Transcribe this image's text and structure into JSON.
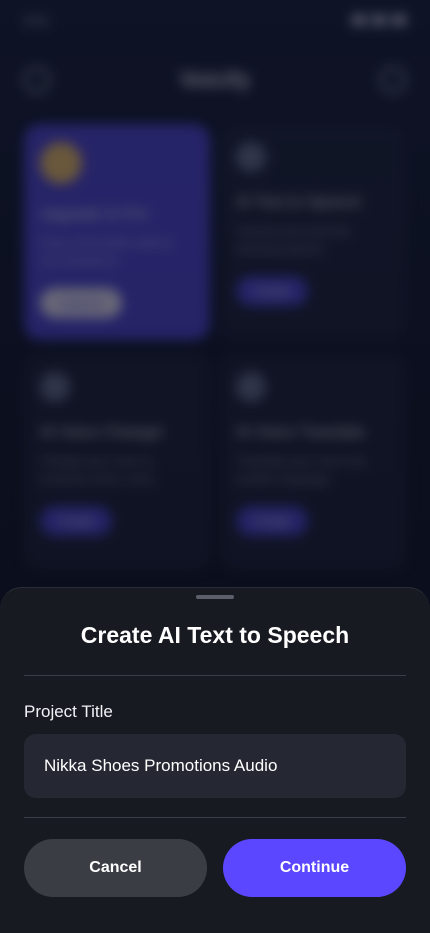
{
  "status": {
    "time": "9:41"
  },
  "app": {
    "title": "Voicify"
  },
  "cards": [
    {
      "title": "Upgrade to Pro",
      "desc": "Enjoy all benefits without any limitations!",
      "button": "Upgrade"
    },
    {
      "title": "AI Text to Speech",
      "desc": "Convert your text into stunning speech",
      "button": "Create"
    },
    {
      "title": "AI Voice Changer",
      "desc": "Change your voice to someone else's voice",
      "button": "Create"
    },
    {
      "title": "AI Voice Translate",
      "desc": "Translate your voice into another language",
      "button": "Create"
    }
  ],
  "sheet": {
    "title": "Create AI Text to Speech",
    "field_label": "Project Title",
    "field_value": "Nikka Shoes Promotions Audio",
    "cancel_label": "Cancel",
    "continue_label": "Continue"
  }
}
